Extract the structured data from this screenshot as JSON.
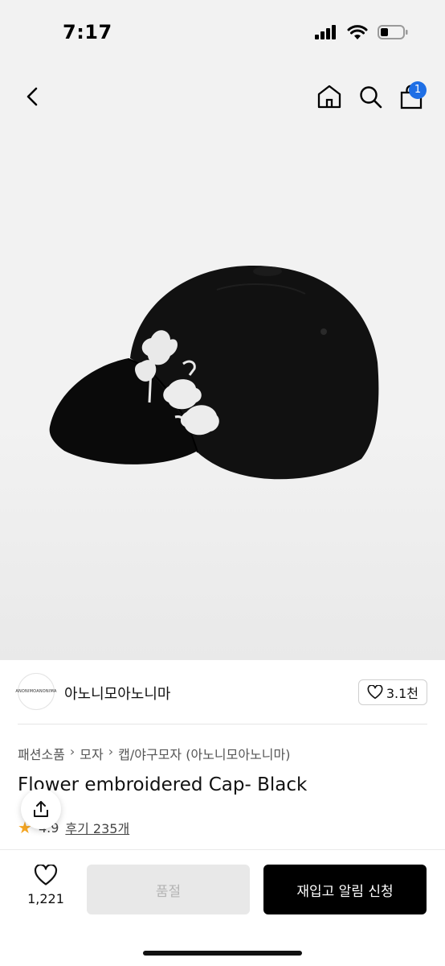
{
  "status_bar": {
    "time": "7:17"
  },
  "nav": {
    "cart_count": "1"
  },
  "brand": {
    "logo_text": "ANONIMOANONIMA",
    "name": "아노니모아노니마",
    "like_count": "3.1천"
  },
  "breadcrumb": {
    "items": [
      "패션소품",
      "모자",
      "캡/야구모자 (아노니모아노니마)"
    ]
  },
  "product": {
    "title": "Flower embroidered Cap- Black",
    "rating": "4.9",
    "review_label": "후기 235개"
  },
  "bottom_bar": {
    "wish_count": "1,221",
    "soldout_label": "품절",
    "restock_label": "재입고 알림 신청"
  },
  "colors": {
    "accent": "#1f6fe5",
    "star": "#f5a623",
    "primary_button": "#000000",
    "disabled_button": "#e8e8e8"
  }
}
